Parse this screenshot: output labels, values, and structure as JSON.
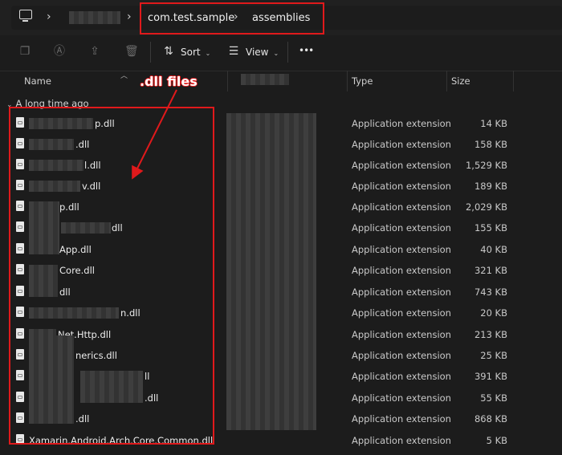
{
  "breadcrumb": {
    "items": [
      "com.test.sample",
      "assemblies"
    ]
  },
  "toolbar": {
    "sort_label": "Sort",
    "view_label": "View",
    "more_label": "•••"
  },
  "columns": {
    "name": "Name",
    "type": "Type",
    "size": "Size"
  },
  "group": {
    "label": "A long time ago"
  },
  "annotation": {
    "label": ".dll files"
  },
  "files": [
    {
      "name": "p.dll",
      "type": "Application extension",
      "size": "14 KB"
    },
    {
      "name": ".dll",
      "type": "Application extension",
      "size": "158 KB"
    },
    {
      "name": "l.dll",
      "type": "Application extension",
      "size": "1,529 KB"
    },
    {
      "name": "v.dll",
      "type": "Application extension",
      "size": "189 KB"
    },
    {
      "name": "p.dll",
      "type": "Application extension",
      "size": "2,029 KB"
    },
    {
      "name": "dll",
      "type": "Application extension",
      "size": "155 KB"
    },
    {
      "name": "App.dll",
      "type": "Application extension",
      "size": "40 KB"
    },
    {
      "name": "Core.dll",
      "type": "Application extension",
      "size": "321 KB"
    },
    {
      "name": "dll",
      "type": "Application extension",
      "size": "743 KB"
    },
    {
      "name": "n.dll",
      "type": "Application extension",
      "size": "20 KB"
    },
    {
      "name": "Net.Http.dll",
      "type": "Application extension",
      "size": "213 KB"
    },
    {
      "name": "nerics.dll",
      "type": "Application extension",
      "size": "25 KB"
    },
    {
      "name": "ll",
      "type": "Application extension",
      "size": "391 KB"
    },
    {
      "name": ".dll",
      "type": "Application extension",
      "size": "55 KB"
    },
    {
      "name": ".dll",
      "type": "Application extension",
      "size": "868 KB"
    },
    {
      "name": "Xamarin.Android.Arch.Core.Common.dll",
      "type": "Application extension",
      "size": "5 KB"
    }
  ],
  "colors": {
    "highlight": "#e0191b",
    "background": "#1c1c1c"
  }
}
